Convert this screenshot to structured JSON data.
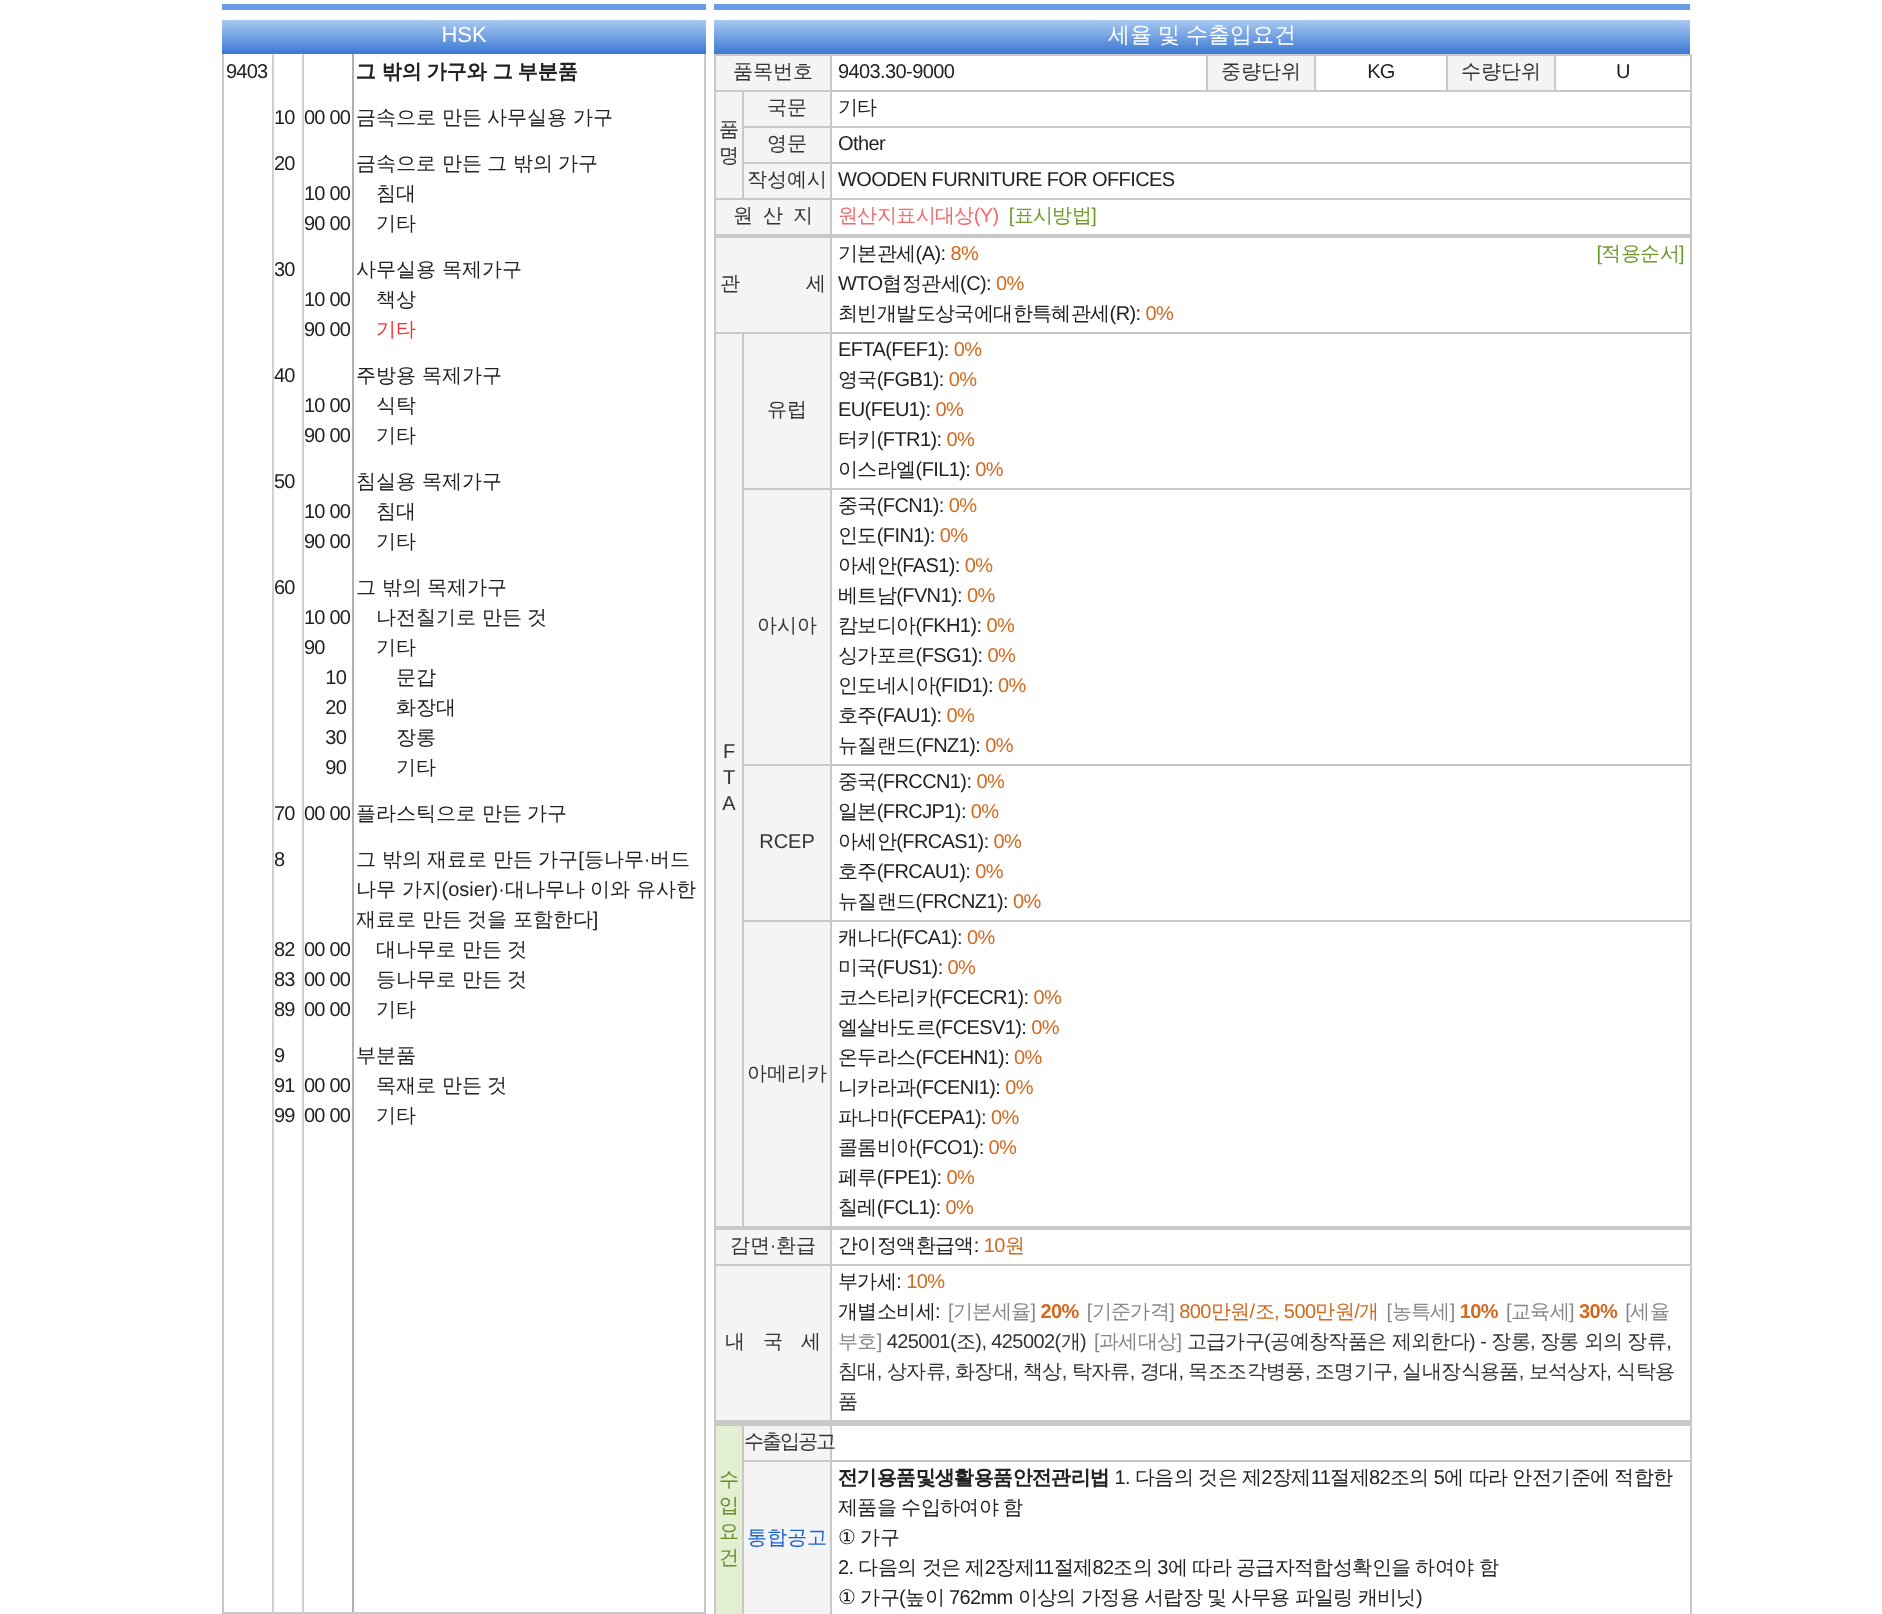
{
  "hsk": {
    "title": "HSK",
    "code": "9403",
    "description": "그 밖의 가구와 그 부분품",
    "groups": [
      {
        "code": "10",
        "subcode": "00 00",
        "description": "금속으로 만든 사무실용 가구",
        "selected": false
      },
      {
        "code": "20",
        "description": "금속으로 만든 그 밖의 가구",
        "selected": false,
        "children": [
          {
            "subcode": "10 00",
            "description": "침대",
            "selected": false
          },
          {
            "subcode": "90 00",
            "description": "기타",
            "selected": false
          }
        ]
      },
      {
        "code": "30",
        "description": "사무실용 목제가구",
        "selected": false,
        "children": [
          {
            "subcode": "10 00",
            "description": "책상",
            "selected": false
          },
          {
            "subcode": "90 00",
            "description": "기타",
            "selected": true
          }
        ]
      },
      {
        "code": "40",
        "description": "주방용 목제가구",
        "selected": false,
        "children": [
          {
            "subcode": "10 00",
            "description": "식탁",
            "selected": false
          },
          {
            "subcode": "90 00",
            "description": "기타",
            "selected": false
          }
        ]
      },
      {
        "code": "50",
        "description": "침실용 목제가구",
        "selected": false,
        "children": [
          {
            "subcode": "10 00",
            "description": "침대",
            "selected": false
          },
          {
            "subcode": "90 00",
            "description": "기타",
            "selected": false
          }
        ]
      },
      {
        "code": "60",
        "description": "그 밖의 목제가구",
        "selected": false,
        "children": [
          {
            "subcode": "10 00",
            "description": "나전칠기로 만든 것",
            "selected": false
          },
          {
            "subcode": "90",
            "description": "기타",
            "selected": false,
            "children": [
              {
                "subcode": "10",
                "description": "문갑",
                "selected": false
              },
              {
                "subcode": "20",
                "description": "화장대",
                "selected": false
              },
              {
                "subcode": "30",
                "description": "장롱",
                "selected": false
              },
              {
                "subcode": "90",
                "description": "기타",
                "selected": false
              }
            ]
          }
        ]
      },
      {
        "code": "70",
        "subcode": "00 00",
        "description": "플라스틱으로 만든 가구",
        "selected": false
      },
      {
        "code": "8",
        "description": "그 밖의 재료로 만든 가구[등나무·버드나무 가지(osier)·대나무나 이와 유사한 재료로 만든 것을 포함한다]",
        "selected": false,
        "children": [
          {
            "code": "82",
            "subcode": "00 00",
            "description": "대나무로 만든 것",
            "selected": false
          },
          {
            "code": "83",
            "subcode": "00 00",
            "description": "등나무로 만든 것",
            "selected": false
          },
          {
            "code": "89",
            "subcode": "00 00",
            "description": "기타",
            "selected": false
          }
        ]
      },
      {
        "code": "9",
        "description": "부분품",
        "selected": false,
        "children": [
          {
            "code": "91",
            "subcode": "00 00",
            "description": "목재로 만든 것",
            "selected": false
          },
          {
            "code": "99",
            "subcode": "00 00",
            "description": "기타",
            "selected": false
          }
        ]
      }
    ]
  },
  "details": {
    "title": "세율 및 수출입요건",
    "item_number": {
      "label": "품목번호",
      "value": "9403.30-9000",
      "weight_unit_label": "중량단위",
      "weight_unit": "KG",
      "quantity_unit_label": "수량단위",
      "quantity_unit": "U"
    },
    "name": {
      "label": "품명",
      "rows": [
        {
          "label": "국문",
          "value": "기타"
        },
        {
          "label": "영문",
          "value": "Other"
        },
        {
          "label": "작성예시",
          "value": "WOODEN FURNITURE FOR OFFICES"
        }
      ]
    },
    "origin": {
      "label": "원 산 지",
      "value": "원산지표시대상(Y)",
      "link": "[표시방법]"
    },
    "tariff": {
      "label": "관 세",
      "link": "[적용순서]",
      "rates": [
        {
          "label": "기본관세(A):",
          "value": "8%"
        },
        {
          "label": "WTO협정관세(C):",
          "value": "0%"
        },
        {
          "label": "최빈개발도상국에대한특혜관세(R):",
          "value": "0%"
        }
      ]
    },
    "fta": {
      "label": "FTA",
      "groups": [
        {
          "region": "유럽",
          "rates": [
            {
              "label": "EFTA(FEF1):",
              "value": "0%"
            },
            {
              "label": "영국(FGB1):",
              "value": "0%"
            },
            {
              "label": "EU(FEU1):",
              "value": "0%"
            },
            {
              "label": "터키(FTR1):",
              "value": "0%"
            },
            {
              "label": "이스라엘(FIL1):",
              "value": "0%"
            }
          ]
        },
        {
          "region": "아시아",
          "rates": [
            {
              "label": "중국(FCN1):",
              "value": "0%"
            },
            {
              "label": "인도(FIN1):",
              "value": "0%"
            },
            {
              "label": "아세안(FAS1):",
              "value": "0%"
            },
            {
              "label": "베트남(FVN1):",
              "value": "0%"
            },
            {
              "label": "캄보디아(FKH1):",
              "value": "0%"
            },
            {
              "label": "싱가포르(FSG1):",
              "value": "0%"
            },
            {
              "label": "인도네시아(FID1):",
              "value": "0%"
            },
            {
              "label": "호주(FAU1):",
              "value": "0%"
            },
            {
              "label": "뉴질랜드(FNZ1):",
              "value": "0%"
            }
          ]
        },
        {
          "region": "RCEP",
          "rates": [
            {
              "label": "중국(FRCCN1):",
              "value": "0%"
            },
            {
              "label": "일본(FRCJP1):",
              "value": "0%"
            },
            {
              "label": "아세안(FRCAS1):",
              "value": "0%"
            },
            {
              "label": "호주(FRCAU1):",
              "value": "0%"
            },
            {
              "label": "뉴질랜드(FRCNZ1):",
              "value": "0%"
            }
          ]
        },
        {
          "region": "아메리카",
          "rates": [
            {
              "label": "캐나다(FCA1):",
              "value": "0%"
            },
            {
              "label": "미국(FUS1):",
              "value": "0%"
            },
            {
              "label": "코스타리카(FCECR1):",
              "value": "0%"
            },
            {
              "label": "엘살바도르(FCESV1):",
              "value": "0%"
            },
            {
              "label": "온두라스(FCEHN1):",
              "value": "0%"
            },
            {
              "label": "니카라과(FCENI1):",
              "value": "0%"
            },
            {
              "label": "파나마(FCEPA1):",
              "value": "0%"
            },
            {
              "label": "콜롬비아(FCO1):",
              "value": "0%"
            },
            {
              "label": "페루(FPE1):",
              "value": "0%"
            },
            {
              "label": "칠레(FCL1):",
              "value": "0%"
            }
          ]
        }
      ]
    },
    "refund": {
      "label": "감면·환급",
      "rates": [
        {
          "label": "간이정액환급액:",
          "value": "10원"
        }
      ]
    },
    "domestic_tax": {
      "label": "내 국 세",
      "rates": [
        {
          "label": "부가세:",
          "value": "10%"
        }
      ],
      "excise": [
        {
          "kind": "head",
          "text": "개별소비세:"
        },
        {
          "kind": "tag",
          "text": "[기본세율]"
        },
        {
          "kind": "rate",
          "text": "20%"
        },
        {
          "kind": "tag",
          "text": "[기준가격]"
        },
        {
          "kind": "amount",
          "text": "800만원/조, 500만원/개"
        },
        {
          "kind": "tag",
          "text": "[농특세]"
        },
        {
          "kind": "rate",
          "text": "10%"
        },
        {
          "kind": "tag",
          "text": "[교육세]"
        },
        {
          "kind": "rate",
          "text": "30%"
        },
        {
          "kind": "tag",
          "text": "[세율부호]"
        },
        {
          "kind": "plain",
          "text": "425001(조), 425002(개)"
        },
        {
          "kind": "tag",
          "text": "[과세대상]"
        },
        {
          "kind": "plain",
          "text": "고급가구(공예창작품은 제외한다) - 장롱, 장롱 외의 장류, 침대, 상자류, 화장대, 책상, 탁자류, 경대, 목조조각병풍, 조명기구, 실내장식용품, 보석상자, 식탁용품"
        }
      ]
    },
    "import_requirements": {
      "label": "수입요건",
      "rows": [
        {
          "label": "수출입공고",
          "link": false,
          "paragraphs": []
        },
        {
          "label": "통합공고",
          "link": true,
          "paragraphs": [
            "**전기용품및생활용품안전관리법** 1. 다음의 것은 제2장제11절제82조의 5에 따라 안전기준에 적합한 제품을 수입하여야 함",
            "① 가구",
            "2. 다음의 것은 제2장제11절제82조의 3에 따라 공급자적합성확인을 하여야 함",
            "① 가구(높이 762mm 이상의 가정용 서랍장 및 사무용 파일링 캐비닛)"
          ]
        }
      ]
    }
  }
}
